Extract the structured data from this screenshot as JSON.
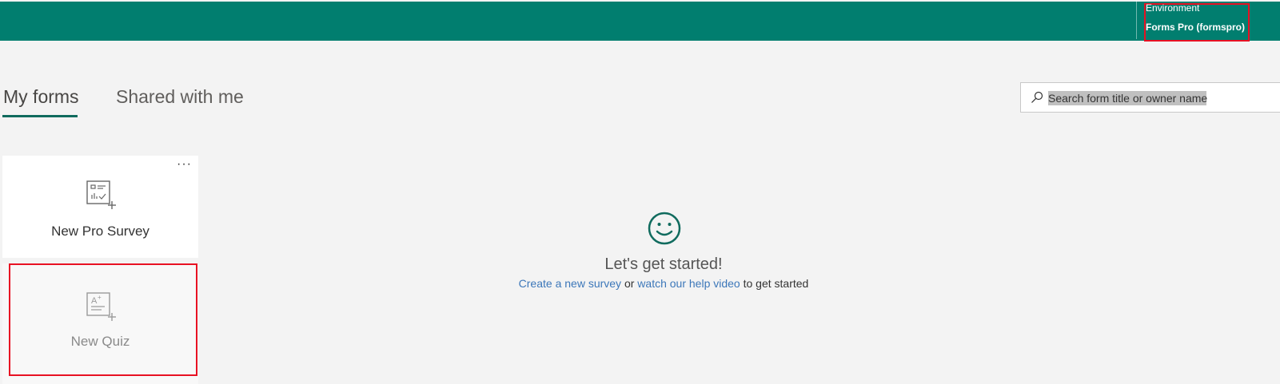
{
  "header": {
    "environment_label": "Environment",
    "environment_value": "Forms Pro (formspro)",
    "accent_color": "#017e6f"
  },
  "tabs": [
    {
      "label": "My forms",
      "active": true
    },
    {
      "label": "Shared with me",
      "active": false
    }
  ],
  "search": {
    "placeholder": "Search form title or owner name",
    "value": "",
    "icon": "search-icon"
  },
  "cards": {
    "survey": {
      "label": "New Pro Survey",
      "icon": "survey-icon",
      "more_label": "···"
    },
    "quiz": {
      "label": "New Quiz",
      "icon": "quiz-icon"
    }
  },
  "empty_state": {
    "icon": "smiley-icon",
    "title": "Let's get started!",
    "create_link": "Create a new survey",
    "or_text": " or ",
    "help_link": "watch our help video",
    "suffix": " to get started"
  }
}
